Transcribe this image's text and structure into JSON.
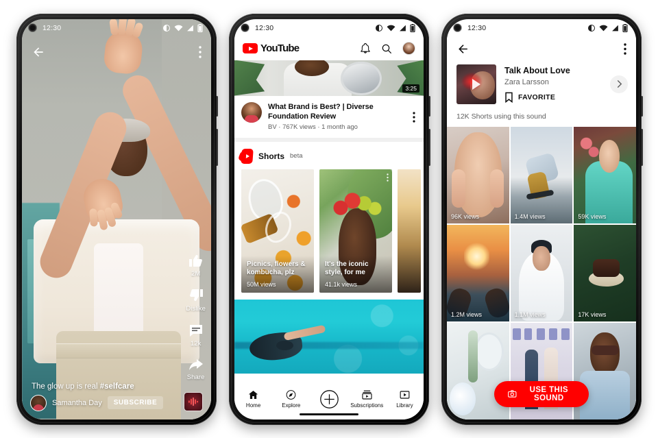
{
  "meta": {
    "background_color": "#ffffff",
    "accent_red": "#FF0000",
    "phones": 3
  },
  "status_bar": {
    "time": "12:30",
    "icons": [
      "contrast-icon",
      "wifi-icon",
      "signal-icon",
      "battery-icon"
    ]
  },
  "phone1": {
    "name": "shorts-player",
    "top_bar": {
      "back": "back-arrow-icon",
      "more": "more-vertical-icon"
    },
    "actions": [
      {
        "icon": "thumbs-up-icon",
        "label": "2M"
      },
      {
        "icon": "thumbs-down-icon",
        "label": "Dislike"
      },
      {
        "icon": "comment-icon",
        "label": "12k"
      },
      {
        "icon": "share-icon",
        "label": "Share"
      }
    ],
    "caption_plain": "The glow up is real ",
    "caption_hashtag": "#selfcare",
    "channel_name": "Samantha Day",
    "subscribe_label": "SUBSCRIBE",
    "sound_thumb": "audio-waveform-icon"
  },
  "phone2": {
    "name": "youtube-home",
    "header": {
      "brand": "YouTube",
      "notifications_icon": "bell-icon",
      "search_icon": "search-icon",
      "avatar": "account-avatar"
    },
    "featured_video": {
      "duration": "3:25",
      "title": "What Brand is Best? | Diverse Foundation Review",
      "meta": "BV · 767K views · 1 month ago",
      "more_icon": "more-vertical-icon"
    },
    "shorts_shelf": {
      "logo": "shorts-icon",
      "title": "Shorts",
      "badge": "beta",
      "cards": [
        {
          "title": "Picnics, flowers & kombucha, plz",
          "views": "50M views"
        },
        {
          "title": "It's the iconic style, for me",
          "views": "41.1k views"
        },
        {
          "title": "",
          "views": ""
        }
      ]
    },
    "bottom_nav": [
      {
        "icon": "home-icon",
        "label": "Home"
      },
      {
        "icon": "compass-icon",
        "label": "Explore"
      },
      {
        "icon": "plus-circle-icon",
        "label": ""
      },
      {
        "icon": "subscriptions-icon",
        "label": "Subscriptions"
      },
      {
        "icon": "library-icon",
        "label": "Library"
      }
    ]
  },
  "phone3": {
    "name": "sound-detail",
    "top_bar": {
      "back": "back-arrow-icon",
      "more": "more-vertical-icon"
    },
    "sound": {
      "title": "Talk About Love",
      "artist": "Zara Larsson",
      "favorite_label": "FAVORITE",
      "favorite_icon": "bookmark-icon",
      "play_icon": "play-icon",
      "chevron_icon": "chevron-right-icon"
    },
    "count_text": "12K Shorts using this sound",
    "grid": [
      {
        "views": "96K views"
      },
      {
        "views": "1.4M views"
      },
      {
        "views": "59K views"
      },
      {
        "views": "1.2M views"
      },
      {
        "views": "1.1M views"
      },
      {
        "views": "17K views"
      },
      {
        "views": ""
      },
      {
        "views": ""
      },
      {
        "views": ""
      }
    ],
    "cta": {
      "label": "USE THIS SOUND",
      "icon": "camera-icon"
    }
  }
}
